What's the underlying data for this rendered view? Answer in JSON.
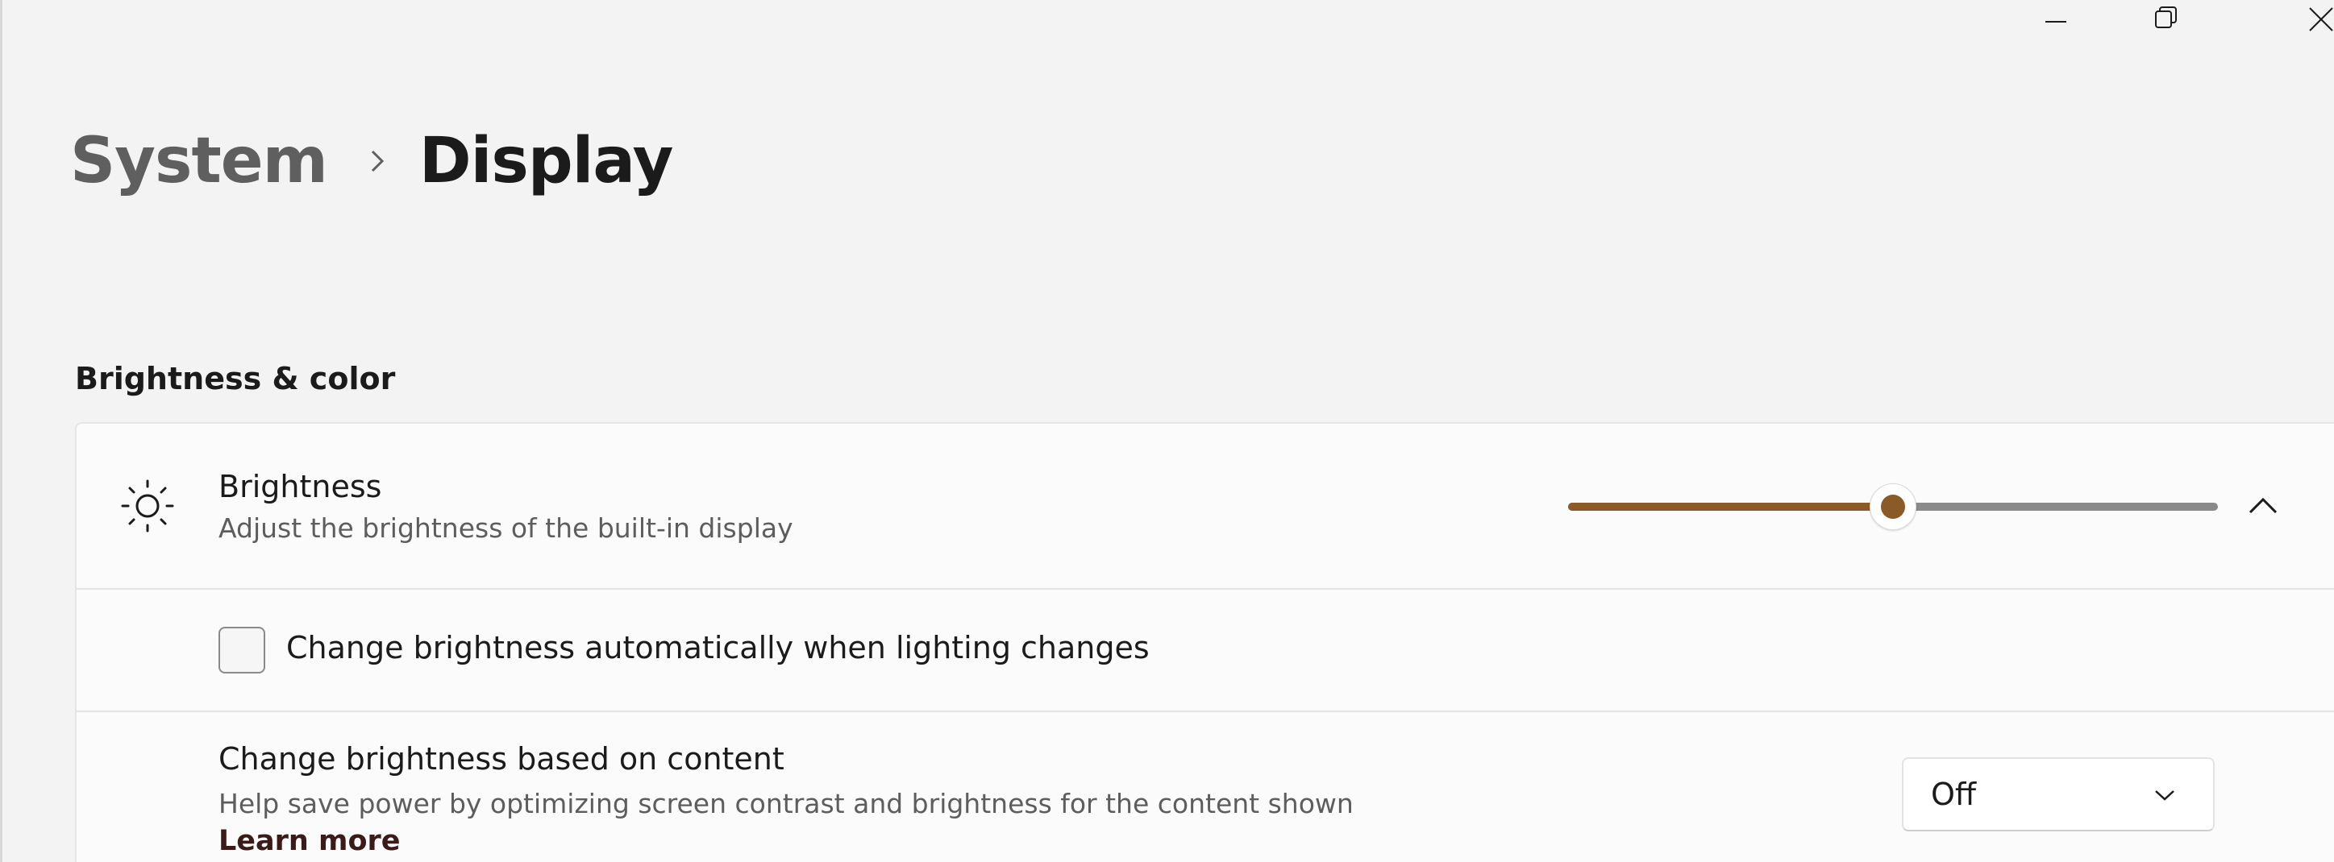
{
  "window": {
    "caption_icons": [
      "minimize-icon",
      "restore-icon",
      "close-icon"
    ]
  },
  "breadcrumb": {
    "parent": "System",
    "separator_icon": "chevron-right-icon",
    "current": "Display"
  },
  "section": {
    "title": "Brightness & color"
  },
  "brightness": {
    "icon": "sun-icon",
    "title": "Brightness",
    "description": "Adjust the brightness of the built-in display",
    "value_fraction": 0.5,
    "expand_icon": "chevron-up-icon",
    "accent_color": "#8a5a28"
  },
  "auto_brightness": {
    "checked": false,
    "label": "Change brightness automatically when lighting changes"
  },
  "content_brightness": {
    "title": "Change brightness based on content",
    "description": "Help save power by optimizing screen contrast and brightness for the content shown",
    "link": "Learn more",
    "dropdown_value": "Off",
    "dropdown_icon": "chevron-down-icon"
  }
}
